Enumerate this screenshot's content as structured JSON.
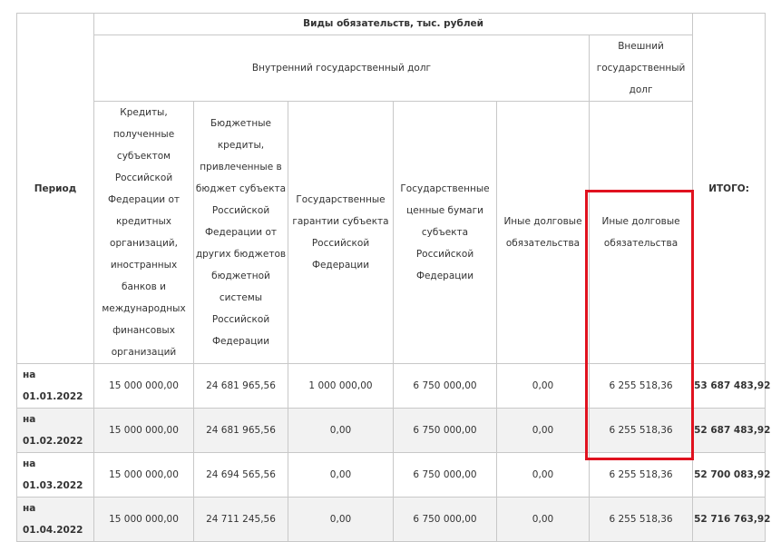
{
  "table": {
    "title": "Виды обязательств, тыс. рублей",
    "period_label": "Период",
    "total_label": "ИТОГО:",
    "internal_group": "Внутренний государственный долг",
    "external_group": "Внешний государственный долг",
    "columns": [
      "Кредиты, полученные субъектом Российской Федерации от кредитных организаций, иностранных банков и международных финансовых организаций",
      "Бюджетные кредиты, привлеченные в бюджет субъекта Российской Федерации от других бюджетов бюджетной системы Российской Федерации",
      "Государственные гарантии субъекта Российской Федерации",
      "Государственные ценные бумаги субъекта Российской Федерации",
      "Иные долговые обязательства",
      "Иные долговые обязательства"
    ],
    "rows": [
      {
        "period": "на 01.01.2022",
        "values": [
          "15 000 000,00",
          "24 681 965,56",
          "1 000 000,00",
          "6 750 000,00",
          "0,00",
          "6 255 518,36"
        ],
        "total": "53 687 483,92"
      },
      {
        "period": "на 01.02.2022",
        "values": [
          "15 000 000,00",
          "24 681 965,56",
          "0,00",
          "6 750 000,00",
          "0,00",
          "6 255 518,36"
        ],
        "total": "52 687 483,92"
      },
      {
        "period": "на 01.03.2022",
        "values": [
          "15 000 000,00",
          "24 694 565,56",
          "0,00",
          "6 750 000,00",
          "0,00",
          "6 255 518,36"
        ],
        "total": "52 700 083,92"
      },
      {
        "period": "на 01.04.2022",
        "values": [
          "15 000 000,00",
          "24 711 245,56",
          "0,00",
          "6 750 000,00",
          "0,00",
          "6 255 518,36"
        ],
        "total": "52 716 763,92"
      }
    ]
  },
  "highlight_color": "#e0121f"
}
